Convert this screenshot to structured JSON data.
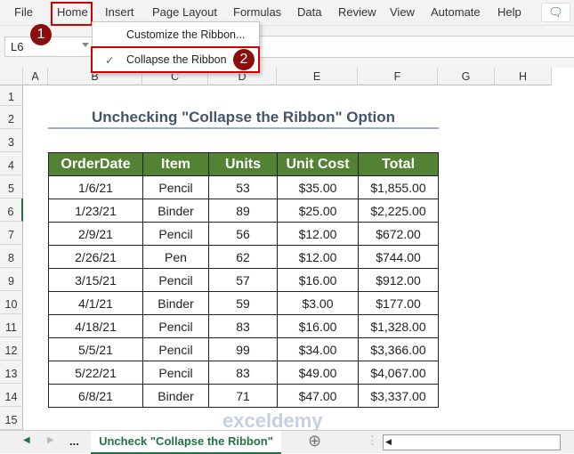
{
  "menubar": {
    "tabs": [
      "File",
      "Home",
      "Insert",
      "Page Layout",
      "Formulas",
      "Data",
      "Review",
      "View",
      "Automate",
      "Help"
    ],
    "comment_icon": "comment-icon"
  },
  "namebox": {
    "value": "L6"
  },
  "context_menu": {
    "items": [
      {
        "label": "Customize the Ribbon...",
        "checked": false
      },
      {
        "label": "Collapse the Ribbon",
        "checked": true
      }
    ],
    "check": "✓"
  },
  "badges": [
    "1",
    "2"
  ],
  "columns": [
    "A",
    "B",
    "C",
    "D",
    "E",
    "F",
    "G",
    "H"
  ],
  "rows": [
    "1",
    "2",
    "3",
    "4",
    "5",
    "6",
    "7",
    "8",
    "9",
    "10",
    "11",
    "12",
    "13",
    "14",
    "15"
  ],
  "title": "Unchecking \"Collapse the Ribbon\" Option",
  "table": {
    "headers": [
      "OrderDate",
      "Item",
      "Units",
      "Unit Cost",
      "Total"
    ],
    "rows": [
      [
        "1/6/21",
        "Pencil",
        "53",
        "$35.00",
        "$1,855.00"
      ],
      [
        "1/23/21",
        "Binder",
        "89",
        "$25.00",
        "$2,225.00"
      ],
      [
        "2/9/21",
        "Pencil",
        "56",
        "$12.00",
        "$672.00"
      ],
      [
        "2/26/21",
        "Pen",
        "62",
        "$12.00",
        "$744.00"
      ],
      [
        "3/15/21",
        "Pencil",
        "57",
        "$16.00",
        "$912.00"
      ],
      [
        "4/1/21",
        "Binder",
        "59",
        "$3.00",
        "$177.00"
      ],
      [
        "4/18/21",
        "Pencil",
        "83",
        "$16.00",
        "$1,328.00"
      ],
      [
        "5/5/21",
        "Pencil",
        "99",
        "$34.00",
        "$3,366.00"
      ],
      [
        "5/22/21",
        "Pencil",
        "83",
        "$49.00",
        "$4,067.00"
      ],
      [
        "6/8/21",
        "Binder",
        "71",
        "$47.00",
        "$3,337.00"
      ]
    ]
  },
  "sheet": {
    "ellipsis": "...",
    "active_tab": "Uncheck \"Collapse the Ribbon\"",
    "add": "⊕"
  },
  "watermark": "exceldemy",
  "colors": {
    "header_green": "#548235",
    "accent_red": "#d00000",
    "title": "#44546a"
  }
}
